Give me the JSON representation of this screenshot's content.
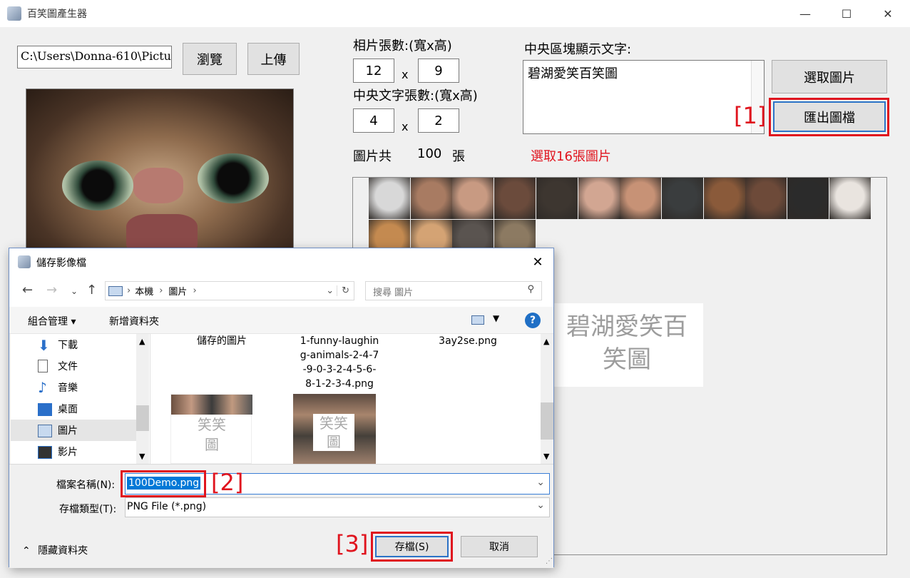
{
  "window": {
    "title": "百笑圖產生器",
    "minimize": "—",
    "maximize": "☐",
    "close": "✕"
  },
  "top": {
    "path_value": "C:\\Users\\Donna-610\\Pictur",
    "browse_label": "瀏覽",
    "upload_label": "上傳"
  },
  "settings": {
    "photo_count_label": "相片張數:(寬x高)",
    "photo_w": "12",
    "photo_h": "9",
    "center_count_label": "中央文字張數:(寬x高)",
    "center_w": "4",
    "center_h": "2",
    "x_sep": "x",
    "total_prefix": "圖片共",
    "total_value": "100",
    "total_suffix": "張",
    "warning": "選取16張圖片"
  },
  "center_text": {
    "label": "中央區塊顯示文字:",
    "value": "碧湖愛笑百笑圖"
  },
  "buttons": {
    "select_images": "選取圖片",
    "export": "匯出圖檔"
  },
  "preview": {
    "overlay_line1": "碧湖愛笑百",
    "overlay_line2": "笑圖"
  },
  "annotations": {
    "a1": "[1]",
    "a2": "[2]",
    "a3": "[3]"
  },
  "dialog": {
    "title": "儲存影像檔",
    "breadcrumb": [
      "本機",
      "圖片"
    ],
    "search_placeholder": "搜尋 圖片",
    "organize": "組合管理",
    "new_folder": "新增資料夾",
    "nav_items": [
      "下載",
      "文件",
      "音樂",
      "桌面",
      "圖片",
      "影片"
    ],
    "files": [
      {
        "name": "儲存的圖片"
      },
      {
        "name": "1-funny-laughin\ng-animals-2-4-7\n-9-0-3-2-4-5-6-\n8-1-2-3-4.png"
      },
      {
        "name": "3ay2se.png"
      }
    ],
    "thumb_text": "笑笑\n圖",
    "filename_label": "檔案名稱(N):",
    "filename_value": "100Demo.png",
    "filetype_label": "存檔類型(T):",
    "filetype_value": "PNG File (*.png)",
    "hide_folders": "隱藏資料夾",
    "save_label": "存檔(S)",
    "cancel_label": "取消"
  },
  "colors": {
    "accent_red": "#e0141e",
    "accent_blue": "#2b73c7"
  }
}
